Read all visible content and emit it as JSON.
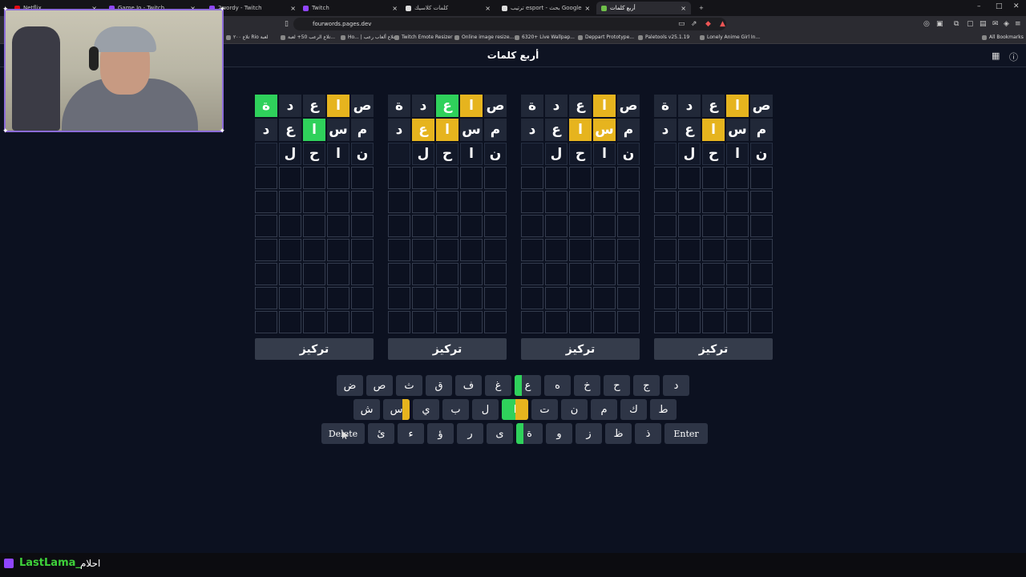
{
  "browser": {
    "tabs": [
      {
        "label": "Netflix",
        "fav": "#e50914"
      },
      {
        "label": "Game Jo - Twitch",
        "fav": "#9146ff"
      },
      {
        "label": "2wordy - Twitch",
        "fav": "#9146ff"
      },
      {
        "label": "Twitch",
        "fav": "#9146ff"
      },
      {
        "label": "كلمات كلاسيك",
        "fav": "#dddddd"
      },
      {
        "label": "ترتيب esport - بحث Google",
        "fav": "#dddddd"
      },
      {
        "label": "أربع كلمات",
        "fav": "#6fbf4a"
      }
    ],
    "url": "fourwords.pages.dev",
    "bookmarks": [
      "تلاع ۲۰۰ Rio لعبة",
      "تلاع الرعب 50+ لعبة...",
      "Ho... | تلاع ألعاب رعب",
      "Twitch Emote Resizer",
      "Online image resize...",
      "6320+ Live Wallpap...",
      "Deppart Prototype...",
      "Paletools v25.1.19",
      "Lonely Anime Girl In...",
      "All Bookmarks"
    ]
  },
  "app": {
    "title": "أربع كلمات",
    "focus_label": "تركيز",
    "boards": [
      {
        "rows": [
          [
            {
              "l": "ص",
              "s": "absent"
            },
            {
              "l": "ا",
              "s": "present"
            },
            {
              "l": "ع",
              "s": "absent"
            },
            {
              "l": "د",
              "s": "absent"
            },
            {
              "l": "ة",
              "s": "correct"
            }
          ],
          [
            {
              "l": "م",
              "s": "absent"
            },
            {
              "l": "س",
              "s": "absent"
            },
            {
              "l": "ا",
              "s": "correct"
            },
            {
              "l": "ع",
              "s": "absent"
            },
            {
              "l": "د",
              "s": "absent"
            }
          ],
          [
            {
              "l": "ن",
              "s": "none"
            },
            {
              "l": "ا",
              "s": "none"
            },
            {
              "l": "ح",
              "s": "none"
            },
            {
              "l": "ل",
              "s": "none"
            },
            {
              "l": "",
              "s": "none"
            }
          ]
        ]
      },
      {
        "rows": [
          [
            {
              "l": "ص",
              "s": "absent"
            },
            {
              "l": "ا",
              "s": "present"
            },
            {
              "l": "ع",
              "s": "correct"
            },
            {
              "l": "د",
              "s": "absent"
            },
            {
              "l": "ة",
              "s": "absent"
            }
          ],
          [
            {
              "l": "م",
              "s": "absent"
            },
            {
              "l": "س",
              "s": "absent"
            },
            {
              "l": "ا",
              "s": "present"
            },
            {
              "l": "ع",
              "s": "present"
            },
            {
              "l": "د",
              "s": "absent"
            }
          ],
          [
            {
              "l": "ن",
              "s": "none"
            },
            {
              "l": "ا",
              "s": "none"
            },
            {
              "l": "ح",
              "s": "none"
            },
            {
              "l": "ل",
              "s": "none"
            },
            {
              "l": "",
              "s": "none"
            }
          ]
        ]
      },
      {
        "rows": [
          [
            {
              "l": "ص",
              "s": "absent"
            },
            {
              "l": "ا",
              "s": "present"
            },
            {
              "l": "ع",
              "s": "absent"
            },
            {
              "l": "د",
              "s": "absent"
            },
            {
              "l": "ة",
              "s": "absent"
            }
          ],
          [
            {
              "l": "م",
              "s": "absent"
            },
            {
              "l": "س",
              "s": "present"
            },
            {
              "l": "ا",
              "s": "present"
            },
            {
              "l": "ع",
              "s": "absent"
            },
            {
              "l": "د",
              "s": "absent"
            }
          ],
          [
            {
              "l": "ن",
              "s": "none"
            },
            {
              "l": "ا",
              "s": "none"
            },
            {
              "l": "ح",
              "s": "none"
            },
            {
              "l": "ل",
              "s": "none"
            },
            {
              "l": "",
              "s": "none"
            }
          ]
        ]
      },
      {
        "rows": [
          [
            {
              "l": "ص",
              "s": "absent"
            },
            {
              "l": "ا",
              "s": "present"
            },
            {
              "l": "ع",
              "s": "absent"
            },
            {
              "l": "د",
              "s": "absent"
            },
            {
              "l": "ة",
              "s": "absent"
            }
          ],
          [
            {
              "l": "م",
              "s": "absent"
            },
            {
              "l": "س",
              "s": "absent"
            },
            {
              "l": "ا",
              "s": "present"
            },
            {
              "l": "ع",
              "s": "absent"
            },
            {
              "l": "د",
              "s": "absent"
            }
          ],
          [
            {
              "l": "ن",
              "s": "none"
            },
            {
              "l": "ا",
              "s": "none"
            },
            {
              "l": "ح",
              "s": "none"
            },
            {
              "l": "ل",
              "s": "none"
            },
            {
              "l": "",
              "s": "none"
            }
          ]
        ]
      }
    ],
    "total_rows": 10,
    "keyboard": [
      [
        {
          "k": "د"
        },
        {
          "k": "ج"
        },
        {
          "k": "ح"
        },
        {
          "k": "خ"
        },
        {
          "k": "ه"
        },
        {
          "k": "ع",
          "m": "correct",
          "side": "left"
        },
        {
          "k": "غ"
        },
        {
          "k": "ف"
        },
        {
          "k": "ق"
        },
        {
          "k": "ث"
        },
        {
          "k": "ص"
        },
        {
          "k": "ض"
        }
      ],
      [
        {
          "k": "ط"
        },
        {
          "k": "ك"
        },
        {
          "k": "م"
        },
        {
          "k": "ن"
        },
        {
          "k": "ت"
        },
        {
          "k": "ا",
          "m": "split"
        },
        {
          "k": "ل"
        },
        {
          "k": "ب"
        },
        {
          "k": "ي"
        },
        {
          "k": "س",
          "m": "present",
          "side": "right"
        },
        {
          "k": "ش"
        }
      ],
      [
        {
          "k": "Enter",
          "wide": true
        },
        {
          "k": "ذ"
        },
        {
          "k": "ظ"
        },
        {
          "k": "ز"
        },
        {
          "k": "و"
        },
        {
          "k": "ة",
          "m": "correct",
          "side": "left"
        },
        {
          "k": "ى"
        },
        {
          "k": "ر"
        },
        {
          "k": "ؤ"
        },
        {
          "k": "ء"
        },
        {
          "k": "ئ"
        },
        {
          "k": "Delete",
          "wide": true
        }
      ]
    ]
  },
  "stream": {
    "chat_user": "LastLama_",
    "chat_message": "احلام"
  },
  "colors": {
    "correct": "#2fd15b",
    "present": "#e6b41e",
    "absent": "#212838",
    "bg": "#0c1120"
  }
}
